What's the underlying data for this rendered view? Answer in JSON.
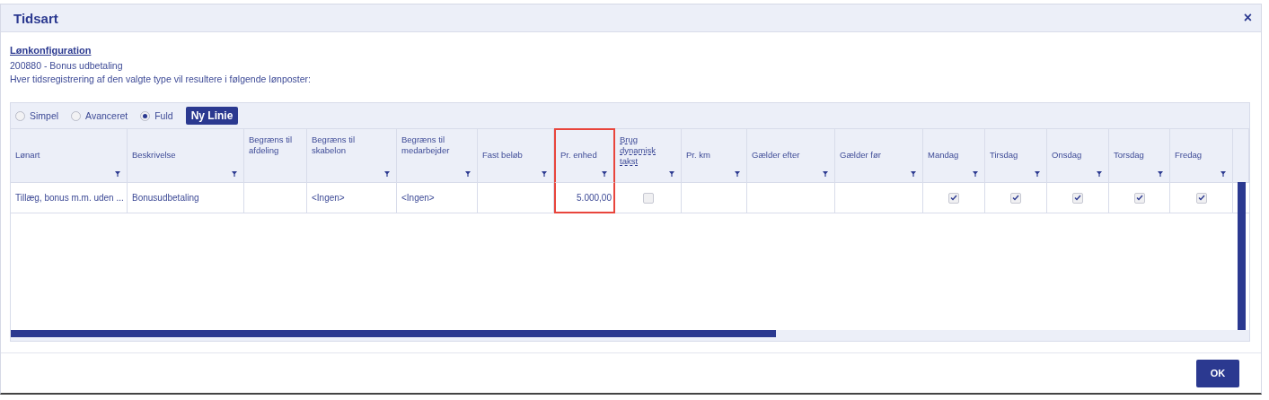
{
  "window": {
    "title": "Tidsart",
    "close": "×"
  },
  "link": "Lønkonfiguration",
  "subtitle": "200880 - Bonus udbetaling",
  "description": "Hver tidsregistrering af den valgte type vil resultere i følgende lønposter:",
  "modes": [
    {
      "label": "Simpel",
      "selected": false
    },
    {
      "label": "Avanceret",
      "selected": false
    },
    {
      "label": "Fuld",
      "selected": true
    }
  ],
  "new_line_button": "Ny Linie",
  "table": {
    "columns": [
      {
        "label": "Lønart",
        "filterable": true,
        "highlighted": false,
        "dotted": false
      },
      {
        "label": "Beskrivelse",
        "filterable": true,
        "highlighted": false,
        "dotted": false
      },
      {
        "label": "Begræns til afdeling",
        "filterable": false,
        "highlighted": false,
        "dotted": false
      },
      {
        "label": "Begræns til skabelon",
        "filterable": true,
        "highlighted": false,
        "dotted": false
      },
      {
        "label": "Begræns til medarbejder",
        "filterable": true,
        "highlighted": false,
        "dotted": false
      },
      {
        "label": "Fast beløb",
        "filterable": true,
        "highlighted": false,
        "dotted": false
      },
      {
        "label": "Pr. enhed",
        "filterable": true,
        "highlighted": true,
        "dotted": false
      },
      {
        "label": "Brug dynamisk takst",
        "filterable": true,
        "highlighted": false,
        "dotted": true
      },
      {
        "label": "Pr. km",
        "filterable": true,
        "highlighted": false,
        "dotted": false
      },
      {
        "label": "Gælder efter",
        "filterable": true,
        "highlighted": false,
        "dotted": false
      },
      {
        "label": "Gælder før",
        "filterable": true,
        "highlighted": false,
        "dotted": false
      },
      {
        "label": "Mandag",
        "filterable": true,
        "highlighted": false,
        "dotted": false
      },
      {
        "label": "Tirsdag",
        "filterable": true,
        "highlighted": false,
        "dotted": false
      },
      {
        "label": "Onsdag",
        "filterable": true,
        "highlighted": false,
        "dotted": false
      },
      {
        "label": "Torsdag",
        "filterable": true,
        "highlighted": false,
        "dotted": false
      },
      {
        "label": "Fredag",
        "filterable": true,
        "highlighted": false,
        "dotted": false
      }
    ],
    "rows": [
      {
        "cells": [
          {
            "kind": "text",
            "text": "Tillæg, bonus m.m. uden ..."
          },
          {
            "kind": "text",
            "text": "Bonusudbetaling"
          },
          {
            "kind": "empty"
          },
          {
            "kind": "text",
            "text": "<Ingen>"
          },
          {
            "kind": "text",
            "text": "<Ingen>"
          },
          {
            "kind": "empty"
          },
          {
            "kind": "number",
            "text": "5.000,00"
          },
          {
            "kind": "checkbox",
            "checked": false
          },
          {
            "kind": "empty"
          },
          {
            "kind": "empty"
          },
          {
            "kind": "empty"
          },
          {
            "kind": "checkbox",
            "checked": true
          },
          {
            "kind": "checkbox",
            "checked": true
          },
          {
            "kind": "checkbox",
            "checked": true
          },
          {
            "kind": "checkbox",
            "checked": true
          },
          {
            "kind": "checkbox",
            "checked": true
          }
        ]
      }
    ]
  },
  "ok_button": "OK"
}
